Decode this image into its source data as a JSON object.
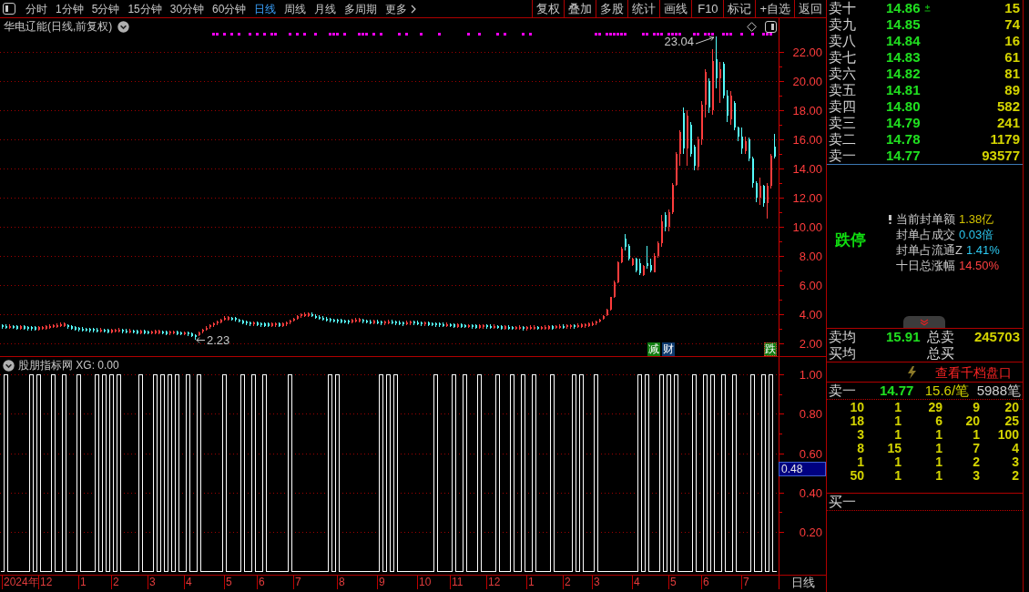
{
  "toolbar": {
    "period_tabs": [
      {
        "label": "分时",
        "selected": false
      },
      {
        "label": "1分钟",
        "selected": false
      },
      {
        "label": "5分钟",
        "selected": false
      },
      {
        "label": "15分钟",
        "selected": false
      },
      {
        "label": "30分钟",
        "selected": false
      },
      {
        "label": "60分钟",
        "selected": false
      },
      {
        "label": "日线",
        "selected": true
      },
      {
        "label": "周线",
        "selected": false
      },
      {
        "label": "月线",
        "selected": false
      },
      {
        "label": "多周期",
        "selected": false
      }
    ],
    "more_menu": {
      "label": "更多"
    },
    "buttons": [
      "复权",
      "叠加",
      "多股",
      "统计",
      "画线",
      "F10",
      "标记",
      "+自选",
      "返回"
    ]
  },
  "price_chart": {
    "title": "华电辽能(日线,前复权)",
    "event_tags": [
      {
        "label": "减",
        "color": "#107c10",
        "outlined": false
      },
      {
        "label": "财",
        "color": "#0e3a6e",
        "outlined": false
      },
      {
        "label": "跌",
        "color": "#107c10",
        "outlined": true
      }
    ],
    "chart_data": [
      {
        "type": "candlestick",
        "ylim": [
          1.13,
          24.31
        ],
        "yticks": [
          {
            "value": 22,
            "label": "22.00"
          },
          {
            "value": 20,
            "label": "20.00"
          },
          {
            "value": 18,
            "label": "18.00"
          },
          {
            "value": 16,
            "label": "16.00"
          },
          {
            "value": 14,
            "label": "14.00"
          },
          {
            "value": 12,
            "label": "12.00"
          },
          {
            "value": 10,
            "label": "10.00"
          },
          {
            "value": 8,
            "label": "8.00"
          },
          {
            "value": 6,
            "label": "6.00"
          },
          {
            "value": 4,
            "label": "4.00"
          },
          {
            "value": 2,
            "label": "2.00"
          }
        ],
        "grid": true,
        "ohlc": [
          [
            3.25,
            3.33,
            3.03,
            3.11
          ],
          [
            3.22,
            3.3,
            3.0,
            3.08
          ],
          [
            3.08,
            3.3,
            3.0,
            3.22
          ],
          [
            3.2,
            3.28,
            2.98,
            3.06
          ],
          [
            3.17,
            3.25,
            2.95,
            3.03
          ],
          [
            3.03,
            3.25,
            2.95,
            3.17
          ],
          [
            3.17,
            3.25,
            2.95,
            3.03
          ],
          [
            3.13,
            3.21,
            2.91,
            2.99
          ],
          [
            3.12,
            3.2,
            2.9,
            2.98
          ],
          [
            3.11,
            3.19,
            2.89,
            2.97
          ],
          [
            2.97,
            3.19,
            2.89,
            3.11
          ],
          [
            3.0,
            3.22,
            2.92,
            3.14
          ],
          [
            3.03,
            3.25,
            2.95,
            3.17
          ],
          [
            3.07,
            3.29,
            2.99,
            3.21
          ],
          [
            3.12,
            3.34,
            3.04,
            3.26
          ],
          [
            3.13,
            3.35,
            3.05,
            3.27
          ],
          [
            3.2,
            3.42,
            3.12,
            3.34
          ],
          [
            3.21,
            3.43,
            3.13,
            3.35
          ],
          [
            3.25,
            3.33,
            3.03,
            3.11
          ],
          [
            3.17,
            3.25,
            2.95,
            3.03
          ],
          [
            3.11,
            3.19,
            2.89,
            2.97
          ],
          [
            3.06,
            3.14,
            2.84,
            2.92
          ],
          [
            3.03,
            3.11,
            2.81,
            2.89
          ],
          [
            3.01,
            3.09,
            2.79,
            2.87
          ],
          [
            3.0,
            3.08,
            2.78,
            2.86
          ],
          [
            2.99,
            3.07,
            2.77,
            2.85
          ],
          [
            2.96,
            3.04,
            2.74,
            2.82
          ],
          [
            2.82,
            3.04,
            2.74,
            2.96
          ],
          [
            2.95,
            3.03,
            2.73,
            2.81
          ],
          [
            2.92,
            3.0,
            2.7,
            2.78
          ],
          [
            2.78,
            3.0,
            2.7,
            2.92
          ],
          [
            2.81,
            3.03,
            2.73,
            2.95
          ],
          [
            2.82,
            3.04,
            2.74,
            2.96
          ],
          [
            2.93,
            3.01,
            2.71,
            2.79
          ],
          [
            2.9,
            2.98,
            2.68,
            2.76
          ],
          [
            2.76,
            2.98,
            2.68,
            2.9
          ],
          [
            2.89,
            2.97,
            2.67,
            2.75
          ],
          [
            2.86,
            2.94,
            2.64,
            2.72
          ],
          [
            2.72,
            2.94,
            2.64,
            2.86
          ],
          [
            2.85,
            2.93,
            2.63,
            2.71
          ],
          [
            2.83,
            2.91,
            2.61,
            2.69
          ],
          [
            2.69,
            2.91,
            2.61,
            2.83
          ],
          [
            2.71,
            2.93,
            2.63,
            2.85
          ],
          [
            2.72,
            2.94,
            2.64,
            2.86
          ],
          [
            2.83,
            2.91,
            2.61,
            2.69
          ],
          [
            2.8,
            2.88,
            2.58,
            2.66
          ],
          [
            2.67,
            2.89,
            2.59,
            2.81
          ],
          [
            2.68,
            2.9,
            2.6,
            2.82
          ],
          [
            2.79,
            2.87,
            2.57,
            2.65
          ],
          [
            2.76,
            2.84,
            2.54,
            2.62
          ],
          [
            2.62,
            2.84,
            2.54,
            2.76
          ],
          [
            2.74,
            2.82,
            2.52,
            2.6
          ],
          [
            2.67,
            2.75,
            2.45,
            2.53
          ],
          [
            2.58,
            2.64,
            2.23,
            2.44
          ],
          [
            2.59,
            2.81,
            2.51,
            2.73
          ],
          [
            2.79,
            3.01,
            2.71,
            2.93
          ],
          [
            2.95,
            3.17,
            2.87,
            3.09
          ],
          [
            3.1,
            3.32,
            3.02,
            3.24
          ],
          [
            3.24,
            3.46,
            3.16,
            3.38
          ],
          [
            3.35,
            3.57,
            3.27,
            3.49
          ],
          [
            3.46,
            3.68,
            3.38,
            3.6
          ],
          [
            3.63,
            3.85,
            3.55,
            3.77
          ],
          [
            3.66,
            3.88,
            3.58,
            3.8
          ],
          [
            3.76,
            3.84,
            3.54,
            3.62
          ],
          [
            3.74,
            3.82,
            3.52,
            3.6
          ],
          [
            3.64,
            3.72,
            3.42,
            3.5
          ],
          [
            3.55,
            3.63,
            3.33,
            3.41
          ],
          [
            3.49,
            3.57,
            3.27,
            3.35
          ],
          [
            3.44,
            3.52,
            3.22,
            3.3
          ],
          [
            3.3,
            3.52,
            3.22,
            3.44
          ],
          [
            3.42,
            3.5,
            3.2,
            3.28
          ],
          [
            3.37,
            3.45,
            3.15,
            3.23
          ],
          [
            3.36,
            3.44,
            3.14,
            3.22
          ],
          [
            3.35,
            3.43,
            3.13,
            3.21
          ],
          [
            3.21,
            3.43,
            3.13,
            3.35
          ],
          [
            3.23,
            3.45,
            3.15,
            3.37
          ],
          [
            3.36,
            3.44,
            3.14,
            3.22
          ],
          [
            3.22,
            3.44,
            3.14,
            3.36
          ],
          [
            3.29,
            3.51,
            3.21,
            3.43
          ],
          [
            3.42,
            3.64,
            3.34,
            3.56
          ],
          [
            3.56,
            3.78,
            3.48,
            3.7
          ],
          [
            3.71,
            3.93,
            3.63,
            3.85
          ],
          [
            3.86,
            4.08,
            3.78,
            4.0
          ],
          [
            3.89,
            4.11,
            3.81,
            4.03
          ],
          [
            3.9,
            4.12,
            3.82,
            4.04
          ],
          [
            4.02,
            4.1,
            3.8,
            3.88
          ],
          [
            3.91,
            3.99,
            3.69,
            3.77
          ],
          [
            3.84,
            3.92,
            3.62,
            3.7
          ],
          [
            3.78,
            3.86,
            3.56,
            3.64
          ],
          [
            3.72,
            3.8,
            3.5,
            3.58
          ],
          [
            3.68,
            3.76,
            3.46,
            3.54
          ],
          [
            3.64,
            3.72,
            3.42,
            3.5
          ],
          [
            3.62,
            3.7,
            3.4,
            3.48
          ],
          [
            3.61,
            3.69,
            3.39,
            3.47
          ],
          [
            3.57,
            3.65,
            3.35,
            3.43
          ],
          [
            3.56,
            3.64,
            3.34,
            3.42
          ],
          [
            3.46,
            3.68,
            3.38,
            3.6
          ],
          [
            3.52,
            3.74,
            3.44,
            3.66
          ],
          [
            3.53,
            3.75,
            3.45,
            3.67
          ],
          [
            3.62,
            3.7,
            3.4,
            3.48
          ],
          [
            3.57,
            3.65,
            3.35,
            3.43
          ],
          [
            3.53,
            3.61,
            3.31,
            3.39
          ],
          [
            3.4,
            3.62,
            3.32,
            3.54
          ],
          [
            3.53,
            3.61,
            3.31,
            3.39
          ],
          [
            3.49,
            3.57,
            3.27,
            3.35
          ],
          [
            3.35,
            3.57,
            3.27,
            3.49
          ],
          [
            3.38,
            3.6,
            3.3,
            3.52
          ],
          [
            3.52,
            3.6,
            3.3,
            3.38
          ],
          [
            3.49,
            3.57,
            3.27,
            3.35
          ],
          [
            3.46,
            3.54,
            3.24,
            3.32
          ],
          [
            3.44,
            3.52,
            3.22,
            3.3
          ],
          [
            3.32,
            3.54,
            3.24,
            3.46
          ],
          [
            3.36,
            3.58,
            3.28,
            3.5
          ],
          [
            3.5,
            3.58,
            3.28,
            3.36
          ],
          [
            3.47,
            3.55,
            3.25,
            3.33
          ],
          [
            3.43,
            3.51,
            3.21,
            3.29
          ],
          [
            3.29,
            3.51,
            3.21,
            3.43
          ],
          [
            3.42,
            3.5,
            3.2,
            3.28
          ],
          [
            3.39,
            3.47,
            3.17,
            3.25
          ],
          [
            3.38,
            3.46,
            3.16,
            3.24
          ],
          [
            3.37,
            3.45,
            3.15,
            3.23
          ],
          [
            3.34,
            3.42,
            3.12,
            3.2
          ],
          [
            3.2,
            3.42,
            3.12,
            3.34
          ],
          [
            3.33,
            3.41,
            3.11,
            3.19
          ],
          [
            3.3,
            3.38,
            3.08,
            3.16
          ],
          [
            3.16,
            3.38,
            3.08,
            3.3
          ],
          [
            3.29,
            3.37,
            3.07,
            3.15
          ],
          [
            3.26,
            3.34,
            3.04,
            3.12
          ],
          [
            3.12,
            3.34,
            3.04,
            3.26
          ],
          [
            3.25,
            3.33,
            3.03,
            3.11
          ],
          [
            3.23,
            3.31,
            3.01,
            3.09
          ],
          [
            3.09,
            3.31,
            3.01,
            3.23
          ],
          [
            3.11,
            3.33,
            3.03,
            3.25
          ],
          [
            3.24,
            3.32,
            3.02,
            3.1
          ],
          [
            3.21,
            3.29,
            2.99,
            3.07
          ],
          [
            3.07,
            3.29,
            2.99,
            3.21
          ],
          [
            3.2,
            3.28,
            2.98,
            3.06
          ],
          [
            3.17,
            3.25,
            2.95,
            3.03
          ],
          [
            3.03,
            3.25,
            2.95,
            3.17
          ],
          [
            3.16,
            3.24,
            2.94,
            3.02
          ],
          [
            3.14,
            3.22,
            2.92,
            3.0
          ],
          [
            3.0,
            3.22,
            2.92,
            3.14
          ],
          [
            3.01,
            3.23,
            2.93,
            3.15
          ],
          [
            3.13,
            3.21,
            2.91,
            2.99
          ],
          [
            2.99,
            3.21,
            2.91,
            3.13
          ],
          [
            3.01,
            3.23,
            2.93,
            3.15
          ],
          [
            3.02,
            3.24,
            2.94,
            3.16
          ],
          [
            3.14,
            3.22,
            2.92,
            3.0
          ],
          [
            3.0,
            3.22,
            2.92,
            3.14
          ],
          [
            3.02,
            3.24,
            2.94,
            3.16
          ],
          [
            3.03,
            3.25,
            2.95,
            3.17
          ],
          [
            3.17,
            3.25,
            2.95,
            3.03
          ],
          [
            3.06,
            3.28,
            2.98,
            3.2
          ],
          [
            3.07,
            3.29,
            2.99,
            3.21
          ],
          [
            3.21,
            3.29,
            2.99,
            3.07
          ],
          [
            3.1,
            3.32,
            3.02,
            3.24
          ],
          [
            3.11,
            3.33,
            3.03,
            3.25
          ],
          [
            3.25,
            3.33,
            3.03,
            3.11
          ],
          [
            3.14,
            3.36,
            3.06,
            3.28
          ],
          [
            3.15,
            3.37,
            3.07,
            3.29
          ],
          [
            3.17,
            3.39,
            3.09,
            3.31
          ],
          [
            3.22,
            3.44,
            3.14,
            3.36
          ],
          [
            3.27,
            3.49,
            3.19,
            3.41
          ],
          [
            3.36,
            3.58,
            3.28,
            3.5
          ],
          [
            3.5,
            3.72,
            3.42,
            3.64
          ],
          [
            3.72,
            3.94,
            3.64,
            3.86
          ],
          [
            3.92,
            4.35,
            3.88,
            4.3
          ],
          [
            4.3,
            5.2,
            4.28,
            5.18
          ],
          [
            5.18,
            6.3,
            5.1,
            6.22
          ],
          [
            6.22,
            7.6,
            6.15,
            7.55
          ],
          [
            7.55,
            8.6,
            7.5,
            8.5
          ],
          [
            9.2,
            9.5,
            8.4,
            8.6
          ],
          [
            8.7,
            8.8,
            7.7,
            7.8
          ],
          [
            7.4,
            7.9,
            7.3,
            7.8
          ],
          [
            7.8,
            7.9,
            6.9,
            7.0
          ],
          [
            7.5,
            7.8,
            6.7,
            6.8
          ],
          [
            6.7,
            7.4,
            6.6,
            7.3
          ],
          [
            7.5,
            8.7,
            7.1,
            7.3
          ],
          [
            7.4,
            7.8,
            6.9,
            7.0
          ],
          [
            6.9,
            8.2,
            6.9,
            8.0
          ],
          [
            8.0,
            9.0,
            7.9,
            8.9
          ],
          [
            8.9,
            10.8,
            8.6,
            10.4
          ],
          [
            10.8,
            11.0,
            9.7,
            10.0
          ],
          [
            10.0,
            11.2,
            9.7,
            11.0
          ],
          [
            11.0,
            13.0,
            10.9,
            12.9
          ],
          [
            12.9,
            15.1,
            12.8,
            15.0
          ],
          [
            15.0,
            16.6,
            14.2,
            16.5
          ],
          [
            17.8,
            18.2,
            15.0,
            15.4
          ],
          [
            15.4,
            18.0,
            14.2,
            17.6
          ],
          [
            17.0,
            17.2,
            14.8,
            15.0
          ],
          [
            15.5,
            15.6,
            13.9,
            14.2
          ],
          [
            14.1,
            16.2,
            13.9,
            16.0
          ],
          [
            16.0,
            18.6,
            15.6,
            18.4
          ],
          [
            18.4,
            20.8,
            17.5,
            20.6
          ],
          [
            20.0,
            20.2,
            17.8,
            18.2
          ],
          [
            18.0,
            22.2,
            17.7,
            21.4
          ],
          [
            21.5,
            23.04,
            19.5,
            20.2
          ],
          [
            20.2,
            21.3,
            18.5,
            20.8
          ],
          [
            21.2,
            21.3,
            18.8,
            19.0
          ],
          [
            19.0,
            19.4,
            17.2,
            17.6
          ],
          [
            17.4,
            19.3,
            17.0,
            19.0
          ],
          [
            18.5,
            18.6,
            16.6,
            16.8
          ],
          [
            16.8,
            16.9,
            15.9,
            16.2
          ],
          [
            16.2,
            16.8,
            15.0,
            15.4
          ],
          [
            15.2,
            16.2,
            15.0,
            15.9
          ],
          [
            16.0,
            16.1,
            14.5,
            14.7
          ],
          [
            14.7,
            14.8,
            12.7,
            13.0
          ],
          [
            13.0,
            13.1,
            11.7,
            12.0
          ],
          [
            12.0,
            13.4,
            11.5,
            12.8
          ],
          [
            12.8,
            12.9,
            11.4,
            11.6
          ],
          [
            11.6,
            13.0,
            10.56,
            12.8
          ],
          [
            12.8,
            15.0,
            12.6,
            14.9
          ],
          [
            15.5,
            16.4,
            14.7,
            14.8
          ]
        ],
        "series": [
          {
            "type": "scatter",
            "marker": "square",
            "color": "#ff00ff",
            "values": [
              null,
              null,
              null,
              null,
              null,
              null,
              null,
              null,
              null,
              null,
              null,
              null,
              null,
              null,
              null,
              null,
              null,
              null,
              null,
              null,
              null,
              null,
              null,
              null,
              null,
              null,
              null,
              null,
              null,
              null,
              null,
              null,
              null,
              null,
              null,
              null,
              null,
              null,
              null,
              null,
              null,
              null,
              null,
              null,
              null,
              null,
              null,
              null,
              null,
              null,
              null,
              null,
              null,
              null,
              null,
              null,
              null,
              null,
              23.2,
              23.2,
              null,
              23.2,
              null,
              23.2,
              null,
              23.2,
              null,
              null,
              23.2,
              null,
              23.2,
              null,
              23.2,
              null,
              23.2,
              23.2,
              null,
              null,
              null,
              23.2,
              null,
              23.2,
              null,
              23.2,
              null,
              null,
              23.2,
              null,
              null,
              null,
              23.2,
              23.2,
              23.2,
              null,
              23.2,
              null,
              null,
              null,
              23.2,
              23.2,
              23.2,
              null,
              23.2,
              null,
              23.2,
              null,
              null,
              null,
              null,
              23.2,
              null,
              23.2,
              null,
              null,
              null,
              23.2,
              null,
              null,
              null,
              null,
              23.2,
              null,
              null,
              null,
              null,
              null,
              null,
              null,
              23.2,
              null,
              null,
              23.2,
              null,
              null,
              null,
              null,
              23.2,
              null,
              23.2,
              null,
              null,
              null,
              null,
              23.2,
              null,
              23.2,
              null,
              null,
              null,
              null,
              null,
              null,
              null,
              null,
              null,
              null,
              null,
              null,
              null,
              null,
              null,
              null,
              null,
              23.2,
              23.2,
              null,
              23.2,
              23.2,
              23.2,
              23.2,
              23.2,
              23.2,
              null,
              null,
              null,
              null,
              23.2,
              23.2,
              null,
              23.2,
              23.2,
              23.2,
              null,
              23.2,
              23.2,
              23.2,
              23.2,
              null,
              null,
              null,
              23.2,
              23.2,
              null,
              23.2,
              23.2,
              23.2,
              null,
              null,
              23.2,
              23.2,
              23.2,
              null,
              null,
              23.2,
              null,
              null,
              23.2,
              null,
              null,
              23.2,
              23.2,
              23.2,
              null
            ]
          }
        ],
        "annotations": [
          "23.04",
          "2.23"
        ]
      }
    ]
  },
  "indicator": {
    "title": "股朋指标网 XG: 0.00",
    "readout": "0.48",
    "chart_data": [
      {
        "type": "step",
        "color": "#ffffff",
        "ylim": [
          -0.02,
          1.09
        ],
        "yticks": [
          {
            "value": 1,
            "label": "1.00"
          },
          {
            "value": 0.8,
            "label": "0.80"
          },
          {
            "value": 0.6,
            "label": "0.60"
          },
          {
            "value": 0.4,
            "label": "0.40"
          },
          {
            "value": 0.2,
            "label": "0.20"
          }
        ],
        "grid": true,
        "values": [
          0,
          1,
          0,
          0,
          0,
          0,
          0,
          0,
          1,
          0,
          1,
          0,
          0,
          0,
          1,
          0,
          0,
          1,
          0,
          0,
          0,
          1,
          0,
          0,
          0,
          0,
          1,
          0,
          1,
          0,
          1,
          0,
          1,
          0,
          0,
          0,
          0,
          0,
          1,
          0,
          0,
          0,
          1,
          0,
          1,
          0,
          1,
          0,
          1,
          0,
          0,
          1,
          0,
          0,
          1,
          0,
          0,
          0,
          0,
          0,
          0,
          1,
          0,
          0,
          0,
          0,
          1,
          0,
          0,
          1,
          0,
          0,
          1,
          0,
          0,
          0,
          0,
          0,
          0,
          1,
          0,
          0,
          0,
          0,
          0,
          0,
          0,
          0,
          0,
          0,
          1,
          0,
          1,
          0,
          0,
          0,
          0,
          0,
          0,
          0,
          0,
          0,
          0,
          0,
          1,
          0,
          1,
          0,
          1,
          0,
          0,
          0,
          0,
          0,
          0,
          0,
          0,
          0,
          0,
          1,
          0,
          0,
          0,
          0,
          1,
          0,
          0,
          1,
          0,
          0,
          0,
          1,
          0,
          0,
          0,
          0,
          1,
          0,
          0,
          0,
          1,
          0,
          0,
          1,
          0,
          0,
          1,
          0,
          0,
          0,
          0,
          1,
          0,
          0,
          0,
          0,
          0,
          1,
          0,
          1,
          0,
          0,
          0,
          1,
          0,
          0,
          0,
          0,
          0,
          0,
          0,
          0,
          0,
          0,
          0,
          1,
          0,
          1,
          0,
          0,
          0,
          1,
          0,
          1,
          0,
          1,
          0,
          0,
          0,
          0,
          1,
          0,
          0,
          1,
          0,
          1,
          0,
          0,
          1,
          0,
          0,
          1,
          0,
          0,
          0,
          0,
          1,
          0,
          0,
          1,
          0,
          1,
          0
        ]
      }
    ]
  },
  "time_axis": {
    "labels": [
      "2024年",
      "12",
      "1",
      "2",
      "3",
      "4",
      "5",
      "6",
      "7",
      "8",
      "9",
      "10",
      "11",
      "12",
      "1",
      "2",
      "3",
      "4",
      "5",
      "6",
      "7"
    ],
    "period": "日线"
  },
  "order_book": {
    "asks": [
      {
        "label": "卖十",
        "price": "14.86",
        "volume": "15",
        "marked": true
      },
      {
        "label": "卖九",
        "price": "14.85",
        "volume": "74",
        "marked": false
      },
      {
        "label": "卖八",
        "price": "14.84",
        "volume": "16",
        "marked": false
      },
      {
        "label": "卖七",
        "price": "14.83",
        "volume": "61",
        "marked": false
      },
      {
        "label": "卖六",
        "price": "14.82",
        "volume": "81",
        "marked": false
      },
      {
        "label": "卖五",
        "price": "14.81",
        "volume": "89",
        "marked": false
      },
      {
        "label": "卖四",
        "price": "14.80",
        "volume": "582",
        "marked": false
      },
      {
        "label": "卖三",
        "price": "14.79",
        "volume": "241",
        "marked": false
      },
      {
        "label": "卖二",
        "price": "14.78",
        "volume": "1179",
        "marked": false
      },
      {
        "label": "卖一",
        "price": "14.77",
        "volume": "93577",
        "marked": false
      }
    ],
    "limit_state": {
      "label": "跌停",
      "stats": [
        {
          "label": "当前封单额",
          "value": "1.38亿",
          "color": "#d4c400",
          "flagged": true
        },
        {
          "label": "封单占成交",
          "value": "0.03倍",
          "color": "#2cc8f0",
          "flagged": false
        },
        {
          "label": "封单占流通Z",
          "value": "1.41%",
          "color": "#2cc8f0",
          "flagged": false
        },
        {
          "label": "十日总涨幅",
          "value": "14.50%",
          "color": "#ff4040",
          "flagged": false
        }
      ]
    },
    "totals": [
      {
        "avg_label": "卖均",
        "avg_value": "15.91",
        "total_label": "总卖",
        "total_value": "245703"
      },
      {
        "avg_label": "买均",
        "total_label": "总买"
      }
    ],
    "depth_link": "查看千档盘口",
    "queue": {
      "label": "卖一",
      "price": "14.77",
      "per_order": "15.6/笔",
      "count": "5988笔",
      "orders": [
        [
          "10",
          "1",
          "29",
          "9",
          "20"
        ],
        [
          "18",
          "1",
          "6",
          "20",
          "25"
        ],
        [
          "3",
          "1",
          "1",
          "1",
          "100"
        ],
        [
          "8",
          "15",
          "1",
          "7",
          "4"
        ],
        [
          "1",
          "1",
          "1",
          "2",
          "3"
        ],
        [
          "50",
          "1",
          "1",
          "3",
          "2"
        ]
      ]
    },
    "bid_queue": {
      "label": "买一"
    }
  }
}
